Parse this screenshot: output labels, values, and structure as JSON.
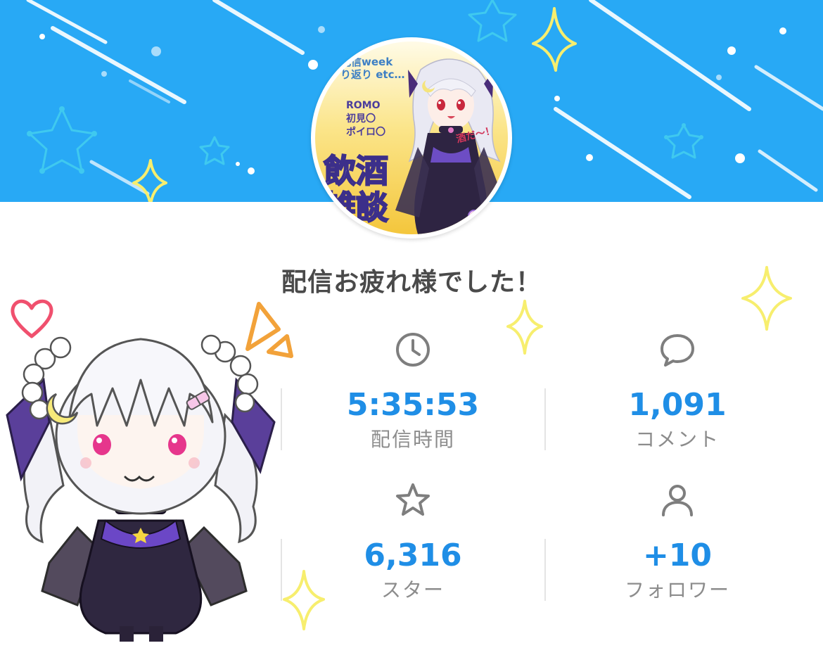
{
  "thumbnail": {
    "top_text": "配信week\nり返り etc…",
    "mid_text": "ROMO\n初見〇\nポイロ〇",
    "big_text": "飲酒\n雑談",
    "speech_text": "酒だ〜！"
  },
  "headline": "配信お疲れ様でした！",
  "stats": [
    {
      "icon": "clock-icon",
      "value": "5:35:53",
      "label": "配信時間"
    },
    {
      "icon": "comment-icon",
      "value": "1,091",
      "label": "コメント"
    },
    {
      "icon": "star-icon",
      "value": "6,316",
      "label": "スター"
    },
    {
      "icon": "person-icon",
      "value": "+10",
      "label": "フォロワー"
    }
  ],
  "colors": {
    "banner": "#28a9f5",
    "value": "#1f8ee6",
    "label": "#8c8c8c",
    "headline": "#4a4a4a",
    "sparkle": "#f7ee6e",
    "heart": "#f0506e",
    "accent_orange": "#f2a23a"
  }
}
